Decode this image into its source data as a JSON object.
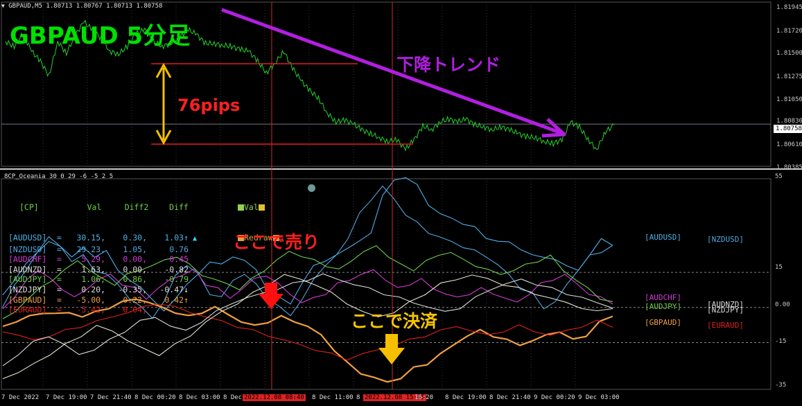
{
  "colors": {
    "background": "#000000",
    "grid": "#3a3a3a",
    "separator": "#c8c8c8",
    "price_line": "#22d42a",
    "vline": "#cc2a2a",
    "hline": "#e51c1c",
    "trend_arrow": "#b21ee0",
    "pips_arrow": "#f2c000",
    "label_green": "#00e000",
    "label_red": "#ff2020",
    "label_purple": "#b21ee0",
    "label_yellow": "#f6c600",
    "sell_arrow": "#ff1010",
    "settle_arrow": "#f6c000",
    "current_price_box": "#ffffff"
  },
  "top_chart": {
    "header": "GBPAUD,M5  1.80713 1.80767 1.80713 1.80758",
    "title_overlay": "GBPAUD 5分足",
    "trend_label": "下降トレンド",
    "pips_label": "76pips",
    "current_price": "1.80758",
    "price_ticks": [
      "1.81945",
      "1.81720",
      "1.81500",
      "1.81275",
      "1.81050",
      "1.80830",
      "1.80610",
      "1.80385"
    ],
    "icon": "triangle-down-icon"
  },
  "indicator": {
    "header": "8CP_Oceania 30 0 29 -6 -5 2 5",
    "columns": [
      "[CP]",
      "Val",
      "Diff2",
      "Diff"
    ],
    "rows": [
      {
        "pair": "[AUDUSD]",
        "val": "30.15,",
        "diff2": "0.30,",
        "diff": "1.03↑",
        "color": "#4fb0e8"
      },
      {
        "pair": "[NZDUSD]",
        "val": "29.23,",
        "diff2": "1.05,",
        "diff": "0.76",
        "color": "#4fa7e0"
      },
      {
        "pair": "[AUDCHF]",
        "val": "5.29,",
        "diff2": "0.00,",
        "diff": "0.45",
        "color": "#d43ad6"
      },
      {
        "pair": "[AUDNZD]",
        "val": "1.63,",
        "diff2": "0.00,",
        "diff": "-0.82",
        "color": "#dedede"
      },
      {
        "pair": "[AUDJPY]",
        "val": "1.06,",
        "diff2": "0.86,",
        "diff": "-0.79",
        "color": "#6fd04a"
      },
      {
        "pair": "[NZDJPY]",
        "val": "0.20,",
        "diff2": "-0.35,",
        "diff": "-0.47↓",
        "color": "#dedede"
      },
      {
        "pair": "[GBPAUD]",
        "val": "-5.00,",
        "diff2": "0.22,",
        "diff": "0.42↑",
        "color": "#f0a040"
      },
      {
        "pair": "[EURAUD]",
        "val": "-5.42,",
        "diff2": "0.04,",
        "diff": "",
        "color": "#e02020"
      }
    ],
    "legend": [
      {
        "label": "Val",
        "color": "#8fd44a"
      },
      {
        "label": "Redraw",
        "color": "#e0a040"
      }
    ],
    "legend_equals": "=",
    "value_ticks": [
      "55",
      "15",
      "0.00",
      "-15",
      "-35"
    ],
    "right_labels": [
      {
        "text": "[AUDUSD]",
        "color": "#4fb0e8"
      },
      {
        "text": "[NZDUSD]",
        "color": "#4fa7e0"
      },
      {
        "text": "[AUDCHF]",
        "color": "#d43ad6"
      },
      {
        "text": "[AUDJPY]",
        "color": "#6fd04a"
      },
      {
        "text": "[AUDNZD]",
        "color": "#dedede"
      },
      {
        "text": "[NZDJPY]",
        "color": "#dedede"
      },
      {
        "text": "[GBPAUD]",
        "color": "#f0a040"
      },
      {
        "text": "[EURAUD]",
        "color": "#e02020"
      }
    ],
    "sell_label": "ここで売り",
    "settle_label": "ここで決済"
  },
  "time_axis": {
    "labels": [
      "7 Dec 2022",
      "7 Dec 19:00",
      "7 Dec 21:40",
      "8 Dec 00:20",
      "8 Dec 03:00",
      "8 Dec 05",
      "8 Dec 11:00",
      "8 Dec",
      "16:20",
      "8 Dec 19:00",
      "8 Dec 21:40",
      "9 Dec 00:20",
      "9 Dec 03:00"
    ],
    "highlight_1": "2022.12.08 08:40",
    "highlight_2": "2022.12.08 15:45"
  },
  "chart_data": {
    "type": "line",
    "title": "GBPAUD,M5",
    "ylim": [
      1.80385,
      1.81945
    ],
    "y_ticks": [
      1.81945,
      1.8172,
      1.815,
      1.81275,
      1.8105,
      1.8083,
      1.8061,
      1.80385
    ],
    "series": [
      {
        "name": "GBPAUD",
        "values": [
          1.816,
          1.8155,
          1.8168,
          1.815,
          1.814,
          1.8125,
          1.816,
          1.8148,
          1.8166,
          1.818,
          1.8172,
          1.8163,
          1.815,
          1.8147,
          1.8155,
          1.8168,
          1.8172,
          1.816,
          1.8155,
          1.8158,
          1.8164,
          1.8172,
          1.8167,
          1.8158,
          1.8158,
          1.8156,
          1.8155,
          1.8152,
          1.815,
          1.814,
          1.8128,
          1.8138,
          1.815,
          1.8133,
          1.812,
          1.811,
          1.8102,
          1.8087,
          1.8078,
          1.808,
          1.8076,
          1.807,
          1.8066,
          1.8062,
          1.8058,
          1.806,
          1.805,
          1.806,
          1.8074,
          1.807,
          1.8078,
          1.8081,
          1.8078,
          1.8081,
          1.8075,
          1.8073,
          1.807,
          1.8073,
          1.807,
          1.8066,
          1.8063,
          1.8062,
          1.8058,
          1.8056,
          1.806,
          1.8078,
          1.8073,
          1.806,
          1.805,
          1.8068,
          1.8075
        ]
      },
      {
        "name": "AUDUSD",
        "values": [
          5,
          12,
          18,
          24,
          28,
          26,
          22,
          25,
          22,
          24,
          16,
          12,
          8,
          4,
          -2,
          4,
          10,
          14,
          20,
          18,
          22,
          20,
          16,
          8,
          4,
          2,
          10,
          18,
          20,
          22,
          26,
          28,
          32,
          48,
          54,
          56,
          52,
          44,
          40,
          38,
          36,
          34,
          30,
          28,
          28,
          25,
          22,
          22,
          20,
          18,
          16,
          22,
          30,
          26
        ]
      },
      {
        "name": "NZDUSD",
        "values": [
          0,
          10,
          15,
          24,
          30,
          26,
          20,
          22,
          16,
          14,
          10,
          4,
          0,
          -4,
          2,
          14,
          18,
          14,
          6,
          4,
          12,
          14,
          10,
          4,
          0,
          -3,
          3,
          12,
          18,
          22,
          30,
          40,
          46,
          52,
          46,
          40,
          36,
          32,
          30,
          28,
          26,
          24,
          22,
          18,
          14,
          8,
          6,
          0,
          2,
          10,
          16,
          22,
          24,
          26
        ]
      },
      {
        "name": "AUDCHF",
        "values": [
          0,
          4,
          12,
          16,
          12,
          8,
          4,
          8,
          12,
          14,
          10,
          8,
          4,
          8,
          12,
          14,
          16,
          10,
          8,
          4,
          8,
          12,
          14,
          10,
          6,
          2,
          4,
          6,
          10,
          12,
          14,
          16,
          12,
          8,
          10,
          12,
          8,
          6,
          4,
          6,
          8,
          6,
          4,
          2,
          6,
          10,
          12,
          14,
          10,
          6,
          4,
          2
        ]
      },
      {
        "name": "AUDJPY",
        "values": [
          -5,
          -2,
          4,
          8,
          12,
          16,
          20,
          16,
          12,
          10,
          14,
          16,
          18,
          20,
          22,
          18,
          14,
          12,
          10,
          8,
          12,
          16,
          20,
          24,
          22,
          20,
          18,
          16,
          20,
          24,
          26,
          22,
          18,
          16,
          20,
          22,
          24,
          20,
          18,
          16,
          14,
          16,
          18,
          20,
          22,
          16,
          12,
          8,
          4,
          2
        ]
      },
      {
        "name": "GBPAUD",
        "values": [
          -8,
          -6,
          -4,
          -2,
          -3,
          -2,
          -4,
          -2,
          0,
          2,
          4,
          2,
          0,
          -2,
          -4,
          -2,
          0,
          -3,
          -6,
          -8,
          -6,
          -4,
          -6,
          -8,
          -12,
          -18,
          -24,
          -28,
          -30,
          -32,
          -30,
          -26,
          -24,
          -20,
          -16,
          -12,
          -10,
          -12,
          -14,
          -16,
          -14,
          -12,
          -10,
          -14,
          -12,
          -6,
          -4
        ]
      },
      {
        "name": "EURAUD",
        "values": [
          -10,
          -12,
          -14,
          -12,
          -10,
          -8,
          -6,
          -4,
          -2,
          0,
          2,
          0,
          -2,
          -4,
          -6,
          -8,
          -10,
          -12,
          -14,
          -16,
          -18,
          -20,
          -22,
          -20,
          -18,
          -16,
          -14,
          -12,
          -10,
          -8,
          -10,
          -12,
          -10,
          -8,
          -10,
          -12,
          -10,
          -8,
          -6,
          -8
        ]
      },
      {
        "name": "AUDNZD",
        "values": [
          -25,
          -20,
          -15,
          -12,
          -16,
          -20,
          -18,
          -14,
          -10,
          -6,
          -4,
          -8,
          -10,
          -6,
          -2,
          2,
          4,
          6,
          8,
          10,
          12,
          14,
          12,
          10,
          8,
          6,
          4,
          2,
          0,
          -2,
          0,
          4,
          8,
          10,
          12,
          10,
          8,
          6,
          4,
          2,
          0
        ]
      },
      {
        "name": "NZDJPY",
        "values": [
          -30,
          -28,
          -24,
          -20,
          -16,
          -12,
          -8,
          -10,
          -14,
          -18,
          -20,
          -16,
          -12,
          -6,
          -2,
          2,
          6,
          10,
          14,
          12,
          10,
          6,
          2,
          -2,
          -4,
          -2,
          2,
          6,
          10,
          12,
          14,
          12,
          10,
          8,
          6,
          4,
          2,
          0,
          -2,
          0
        ]
      }
    ]
  }
}
